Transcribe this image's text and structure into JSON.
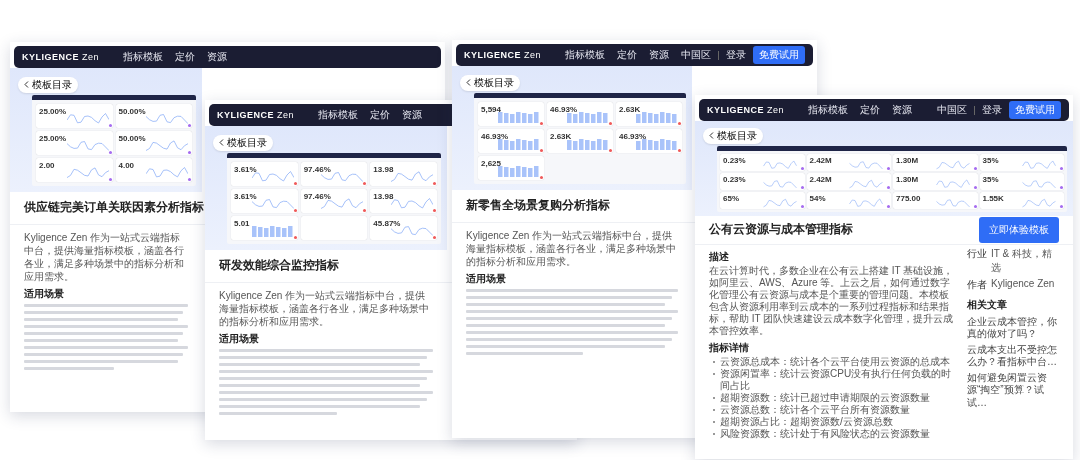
{
  "cards": [
    {
      "color": "#a66cf0",
      "nav": {
        "logo": "KYLIGENCE",
        "logo_suffix": "Zen",
        "links": [
          "指标模板",
          "定价",
          "资源"
        ]
      },
      "back_button": "模板目录",
      "metric_rows": [
        [
          {
            "value": "25.00%",
            "kind": "line"
          },
          {
            "value": "50.00%",
            "kind": "line"
          }
        ],
        [
          {
            "value": "25.00%",
            "kind": "line"
          },
          {
            "value": "50.00%",
            "kind": "line"
          }
        ],
        [
          {
            "value": "2.00",
            "kind": "line"
          },
          {
            "value": "4.00",
            "kind": "line"
          }
        ]
      ],
      "title": "供应链完美订单关联因素分析指标",
      "sections": [
        {
          "kind": "paragraph",
          "text": "Kyligence Zen 作为一站式云端指标中台，提供海量指标模板，涵盖各行各业，满足多种场景中的指标分析和应用需求。"
        },
        {
          "kind": "blurred",
          "heading": "适用场景"
        }
      ]
    },
    {
      "color": "#f05a5a",
      "nav": {
        "logo": "KYLIGENCE",
        "logo_suffix": "Zen",
        "links": [
          "指标模板",
          "定价",
          "资源"
        ]
      },
      "back_button": "模板目录",
      "metric_rows": [
        [
          {
            "value": "3.61%",
            "kind": "line"
          },
          {
            "value": "97.46%",
            "kind": "line"
          },
          {
            "value": "13.98",
            "kind": "line"
          }
        ],
        [
          {
            "value": "3.61%",
            "kind": "line"
          },
          {
            "value": "97.46%",
            "kind": "line"
          },
          {
            "value": "13.98",
            "kind": "line"
          }
        ],
        [
          {
            "value": "5.01",
            "kind": "bar"
          },
          {
            "kind": "empty"
          },
          {
            "value": "45.87%",
            "kind": "line"
          }
        ]
      ],
      "title": "研发效能综合监控指标",
      "sections": [
        {
          "kind": "paragraph",
          "text": "Kyligence Zen 作为一站式云端指标中台，提供海量指标模板，涵盖各行各业，满足多种场景中的指标分析和应用需求。"
        },
        {
          "kind": "blurred",
          "heading": "适用场景"
        }
      ]
    },
    {
      "color": "#f05a5a",
      "nav": {
        "logo": "KYLIGENCE",
        "logo_suffix": "Zen",
        "links": [
          "指标模板",
          "定价",
          "资源"
        ],
        "region": "中国区",
        "login": "登录",
        "cta": "免费试用"
      },
      "back_button": "模板目录",
      "metric_rows": [
        [
          {
            "value": "5,594",
            "kind": "bar"
          },
          {
            "value": "46.93%",
            "kind": "bar"
          },
          {
            "value": "2.63K",
            "kind": "bar"
          }
        ],
        [
          {
            "value": "46.93%",
            "kind": "bar"
          },
          {
            "value": "2.63K",
            "kind": "bar"
          },
          {
            "value": "46.93%",
            "kind": "bar"
          }
        ],
        [
          {
            "value": "2,625",
            "kind": "bar"
          }
        ]
      ],
      "title": "新零售全场景复购分析指标",
      "sections": [
        {
          "kind": "paragraph",
          "text": "Kyligence Zen 作为一站式云端指标中台，提供海量指标模板，涵盖各行各业，满足多种场景中的指标分析和应用需求。"
        },
        {
          "kind": "blurred",
          "heading": "适用场景"
        }
      ]
    },
    {
      "color": "#a66cf0",
      "nav": {
        "logo": "KYLIGENCE",
        "logo_suffix": "Zen",
        "links": [
          "指标模板",
          "定价",
          "资源"
        ],
        "region": "中国区",
        "login": "登录",
        "cta": "免费试用"
      },
      "back_button": "模板目录",
      "metric_rows": [
        [
          {
            "value": "0.23%",
            "kind": "line"
          },
          {
            "value": "2.42M",
            "kind": "line"
          },
          {
            "value": "1.30M",
            "kind": "line"
          },
          {
            "value": "35%",
            "kind": "line"
          }
        ],
        [
          {
            "value": "0.23%",
            "kind": "line"
          },
          {
            "value": "2.42M",
            "kind": "line"
          },
          {
            "value": "1.30M",
            "kind": "line"
          },
          {
            "value": "35%",
            "kind": "line"
          }
        ],
        [
          {
            "value": "65%",
            "kind": "line"
          },
          {
            "value": "54%",
            "kind": "line"
          },
          {
            "value": "775.00",
            "kind": "line"
          },
          {
            "value": "1.55K",
            "kind": "line"
          }
        ]
      ],
      "title": "公有云资源与成本管理指标",
      "cta_button": "立即体验模板",
      "sections": [
        {
          "kind": "paragraph",
          "heading": "描述",
          "text": "在云计算时代，多数企业在公有云上搭建 IT 基础设施，如阿里云、AWS、Azure 等。上云之后，如何通过数字化管理公有云资源与成本是个重要的管理问题。本模板包含从资源利用率到云成本的一系列过程指标和结果指标，帮助 IT 团队快速建设云成本数字化管理，提升云成本管控效率。"
        },
        {
          "kind": "list",
          "heading": "指标详情",
          "items": [
            "云资源总成本：统计各个云平台使用云资源的总成本",
            "资源闲置率：统计云资源CPU没有执行任何负载的时间占比",
            "超期资源数：统计已超过申请期限的云资源数量",
            "云资源总数：统计各个云平台所有资源数量",
            "超期资源占比：超期资源数/云资源总数",
            "风险资源数：统计处于有风险状态的云资源数量"
          ]
        }
      ],
      "meta": [
        {
          "label": "行业",
          "value": "IT & 科技，精选"
        },
        {
          "label": "作者",
          "value": "Kyligence Zen"
        }
      ],
      "related": {
        "heading": "相关文章",
        "links": [
          "企业云成本管控，你真的做对了吗？",
          "云成本支出不受控怎么办？看指标中台…",
          "如何避免闲置云资源“掏空”预算？试试…"
        ]
      }
    }
  ]
}
